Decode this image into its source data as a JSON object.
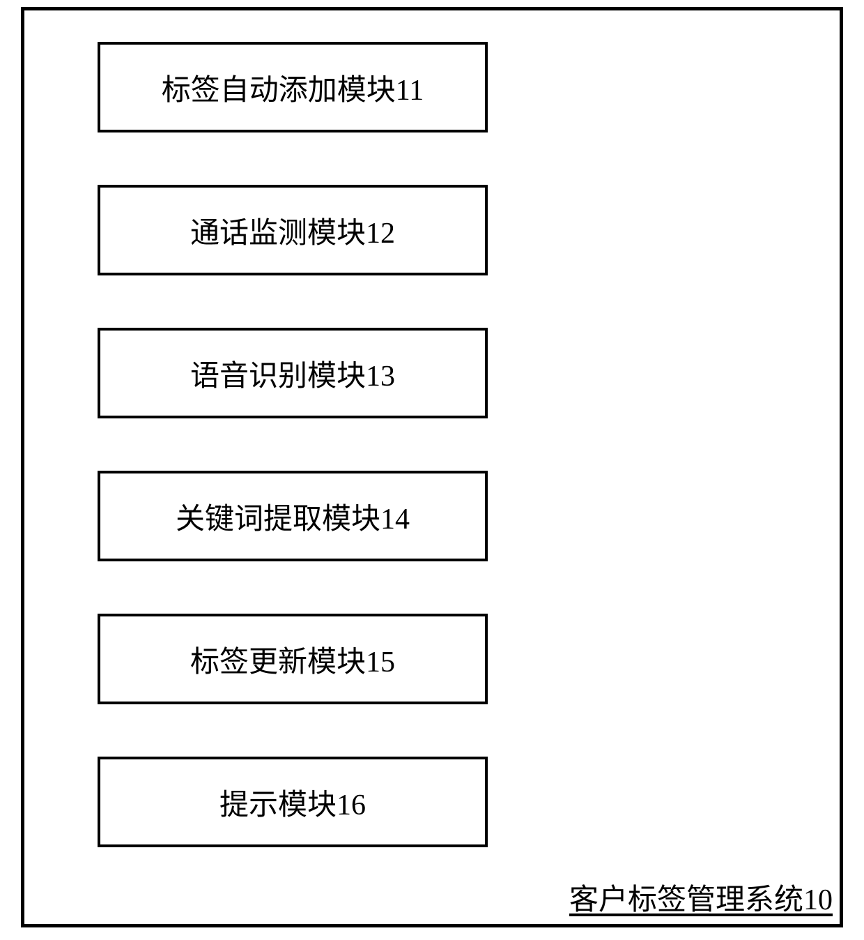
{
  "system": {
    "label": "客户标签管理系统10"
  },
  "modules": [
    {
      "label": "标签自动添加模块11"
    },
    {
      "label": "通话监测模块12"
    },
    {
      "label": "语音识别模块13"
    },
    {
      "label": "关键词提取模块14"
    },
    {
      "label": "标签更新模块15"
    },
    {
      "label": "提示模块16"
    }
  ]
}
